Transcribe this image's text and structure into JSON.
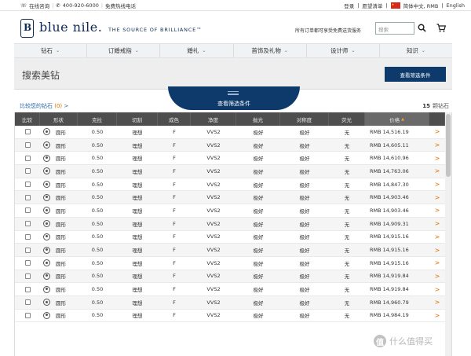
{
  "utility": {
    "chat": "在线咨询",
    "phone": "400-920-6000",
    "free_call": "免费热线电话",
    "login": "登录",
    "wishlist": "愿望清单",
    "locale": "简体中文, RMB",
    "english": "English"
  },
  "header": {
    "logo_letter": "B",
    "logo": "blue nile.",
    "tagline": "THE SOURCE OF BRILLIANCE™",
    "note": "所有订单都可享受免费送货服务",
    "search_placeholder": "搜索"
  },
  "nav": [
    {
      "label": "钻石"
    },
    {
      "label": "订婚戒指"
    },
    {
      "label": "婚礼"
    },
    {
      "label": "首饰及礼物"
    },
    {
      "label": "设计师"
    },
    {
      "label": "知识"
    }
  ],
  "page": {
    "title": "搜索美钻",
    "filter_button": "查看筛选条件",
    "filter_tab": "查看筛选条件",
    "compare_prefix": "比较您的钻石",
    "compare_count": "(0)",
    "compare_arrow": ">",
    "result_count": "15",
    "result_label": "颗钻石"
  },
  "table": {
    "headers": [
      "比较",
      "形状",
      "克拉",
      "切割",
      "成色",
      "净度",
      "抛光",
      "对称度",
      "荧光",
      "价格",
      ""
    ],
    "rows": [
      {
        "shape": "圆形",
        "carat": "0.50",
        "cut": "理想",
        "color": "F",
        "clarity": "VVS2",
        "polish": "极好",
        "symmetry": "极好",
        "fluor": "无",
        "price": "RMB 14,516.19",
        "go": ">"
      },
      {
        "shape": "圆形",
        "carat": "0.50",
        "cut": "理想",
        "color": "F",
        "clarity": "VVS2",
        "polish": "极好",
        "symmetry": "极好",
        "fluor": "无",
        "price": "RMB 14,605.11",
        "go": ">"
      },
      {
        "shape": "圆形",
        "carat": "0.50",
        "cut": "理想",
        "color": "F",
        "clarity": "VVS2",
        "polish": "极好",
        "symmetry": "极好",
        "fluor": "无",
        "price": "RMB 14,610.96",
        "go": ">"
      },
      {
        "shape": "圆形",
        "carat": "0.50",
        "cut": "理想",
        "color": "F",
        "clarity": "VVS2",
        "polish": "极好",
        "symmetry": "极好",
        "fluor": "无",
        "price": "RMB 14,763.06",
        "go": ">"
      },
      {
        "shape": "圆形",
        "carat": "0.50",
        "cut": "理想",
        "color": "F",
        "clarity": "VVS2",
        "polish": "极好",
        "symmetry": "极好",
        "fluor": "无",
        "price": "RMB 14,847.30",
        "go": ">"
      },
      {
        "shape": "圆形",
        "carat": "0.50",
        "cut": "理想",
        "color": "F",
        "clarity": "VVS2",
        "polish": "极好",
        "symmetry": "极好",
        "fluor": "无",
        "price": "RMB 14,903.46",
        "go": ">"
      },
      {
        "shape": "圆形",
        "carat": "0.50",
        "cut": "理想",
        "color": "F",
        "clarity": "VVS2",
        "polish": "极好",
        "symmetry": "极好",
        "fluor": "无",
        "price": "RMB 14,903.46",
        "go": ">"
      },
      {
        "shape": "圆形",
        "carat": "0.50",
        "cut": "理想",
        "color": "F",
        "clarity": "VVS2",
        "polish": "极好",
        "symmetry": "极好",
        "fluor": "无",
        "price": "RMB 14,909.31",
        "go": ">"
      },
      {
        "shape": "圆形",
        "carat": "0.50",
        "cut": "理想",
        "color": "F",
        "clarity": "VVS2",
        "polish": "极好",
        "symmetry": "极好",
        "fluor": "无",
        "price": "RMB 14,915.16",
        "go": ">"
      },
      {
        "shape": "圆形",
        "carat": "0.50",
        "cut": "理想",
        "color": "F",
        "clarity": "VVS2",
        "polish": "极好",
        "symmetry": "极好",
        "fluor": "无",
        "price": "RMB 14,915.16",
        "go": ">"
      },
      {
        "shape": "圆形",
        "carat": "0.50",
        "cut": "理想",
        "color": "F",
        "clarity": "VVS2",
        "polish": "极好",
        "symmetry": "极好",
        "fluor": "无",
        "price": "RMB 14,915.16",
        "go": ">"
      },
      {
        "shape": "圆形",
        "carat": "0.50",
        "cut": "理想",
        "color": "F",
        "clarity": "VVS2",
        "polish": "极好",
        "symmetry": "极好",
        "fluor": "无",
        "price": "RMB 14,919.84",
        "go": ">"
      },
      {
        "shape": "圆形",
        "carat": "0.50",
        "cut": "理想",
        "color": "F",
        "clarity": "VVS2",
        "polish": "极好",
        "symmetry": "极好",
        "fluor": "无",
        "price": "RMB 14,919.84",
        "go": ">"
      },
      {
        "shape": "圆形",
        "carat": "0.50",
        "cut": "理想",
        "color": "F",
        "clarity": "VVS2",
        "polish": "极好",
        "symmetry": "极好",
        "fluor": "无",
        "price": "RMB 14,960.79",
        "go": ">"
      },
      {
        "shape": "圆形",
        "carat": "0.50",
        "cut": "理想",
        "color": "F",
        "clarity": "VVS2",
        "polish": "极好",
        "symmetry": "极好",
        "fluor": "无",
        "price": "RMB 14,984.19",
        "go": ">"
      }
    ]
  },
  "watermark": {
    "mark": "值",
    "text": "什么值得买"
  },
  "colors": {
    "brand_navy": "#0d2a54",
    "button_navy": "#0d3a6a",
    "accent_orange": "#e07000",
    "header_gray": "#4e4e4e"
  }
}
